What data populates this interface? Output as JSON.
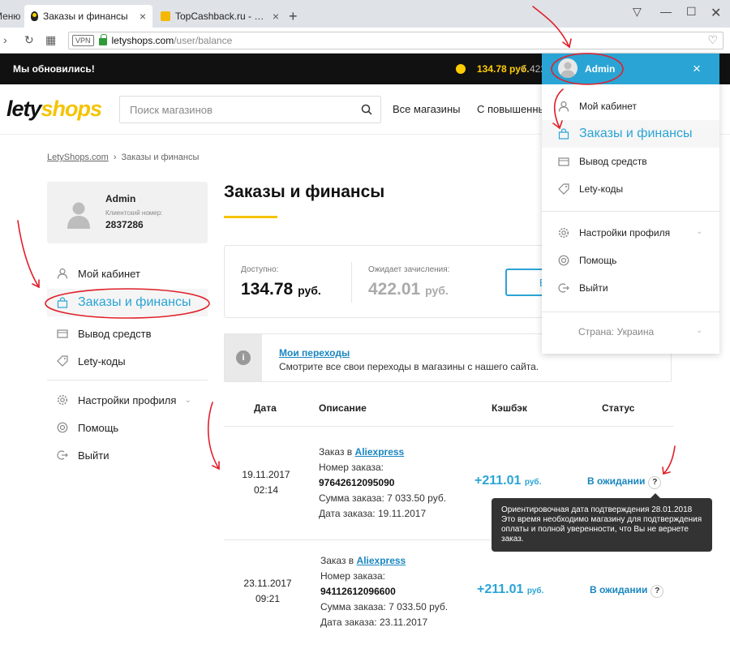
{
  "browser": {
    "partial_tab_label": "Меню",
    "active_tab_label": "Заказы и финансы",
    "inactive_tab_label": "TopCashback.ru - Топ лучш",
    "url_host": "letyshops.com",
    "url_path": "/user/balance",
    "vpn_label": "VPN"
  },
  "strip": {
    "updated_text": "Мы обновились!",
    "balance": "134.78 руб.",
    "slash": "/",
    "pending_partial": "422"
  },
  "header": {
    "logo_part1": "lety",
    "logo_part2": "shops",
    "search_placeholder": "Поиск магазинов",
    "nav_all": "Все магазины",
    "nav_increased": "С повышенны"
  },
  "breadcrumb": {
    "home": "LetyShops.com",
    "sep": "›",
    "current": "Заказы и финансы"
  },
  "profile": {
    "name": "Admin",
    "client_label": "Клиентский номер:",
    "client_number": "2837286"
  },
  "left_menu": {
    "cabinet": "Мой кабинет",
    "orders": "Заказы и финансы",
    "withdraw": "Вывод средств",
    "codes": "Lety-коды",
    "settings": "Настройки профиля",
    "help": "Помощь",
    "logout": "Выйти"
  },
  "main": {
    "title": "Заказы и финансы",
    "available_label": "Доступно:",
    "available_value": "134.78",
    "available_currency": "руб.",
    "pending_label": "Ожидает зачисления:",
    "pending_value": "422.01",
    "pending_currency": "руб.",
    "button_partial": "В"
  },
  "info": {
    "icon_glyph": "i",
    "link": "Мои переходы",
    "text": "Смотрите все свои переходы в магазины с нашего сайта."
  },
  "table": {
    "headers": {
      "date": "Дата",
      "description": "Описание",
      "cashback": "Кэшбэк",
      "status": "Статус"
    },
    "rows": [
      {
        "date": "19.11.2017",
        "time": "02:14",
        "order_in": "Заказ в",
        "store": "Aliexpress",
        "order_no_label": "Номер заказа:",
        "order_no": "97642612095090",
        "sum": "Сумма заказа: 7 033.50 руб.",
        "order_date": "Дата заказа: 19.11.2017",
        "cashback": "+211.01",
        "cashback_currency": "руб.",
        "status": "В ожидании",
        "help": "?"
      },
      {
        "date": "23.11.2017",
        "time": "09:21",
        "order_in": "Заказ в",
        "store": "Aliexpress",
        "order_no_label": "Номер заказа:",
        "order_no": "94112612096600",
        "sum": "Сумма заказа: 7 033.50 руб.",
        "order_date": "Дата заказа: 23.11.2017",
        "cashback": "+211.01",
        "cashback_currency": "руб.",
        "status": "В ожидании",
        "help": "?"
      }
    ]
  },
  "tooltip": {
    "text": "Ориентировочная дата подтверждения 28.01.2018 Это время необходимо магазину для подтверждения оплаты и полной уверенности, что Вы не вернете заказ."
  },
  "dropdown": {
    "name": "Admin",
    "close": "×",
    "cabinet": "Мой кабинет",
    "orders": "Заказы и финансы",
    "withdraw": "Вывод средств",
    "codes": "Lety-коды",
    "settings": "Настройки профиля",
    "help": "Помощь",
    "logout": "Выйти",
    "country": "Страна: Украина"
  },
  "colors": {
    "accent": "#2aa4d5",
    "brand_yellow": "#f4c400",
    "annotation_red": "#e0202a"
  }
}
